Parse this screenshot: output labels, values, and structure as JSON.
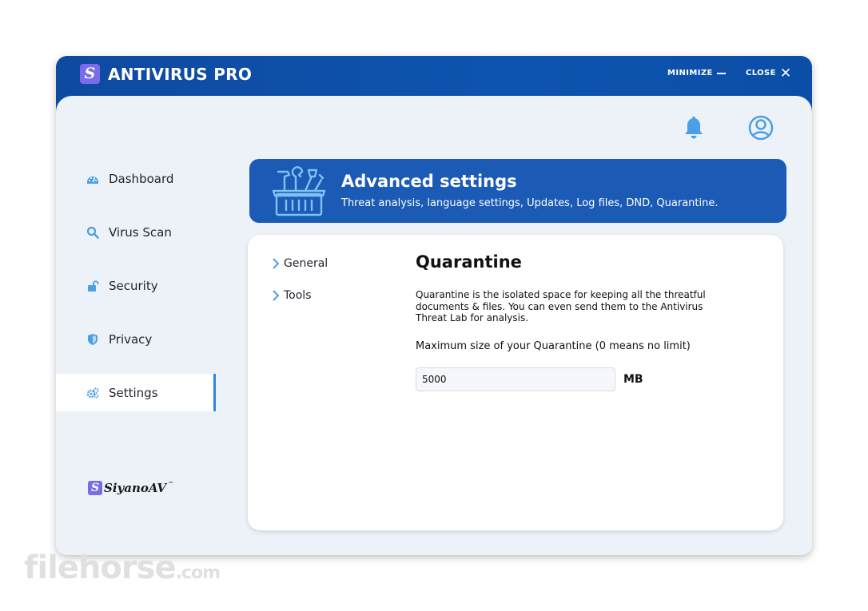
{
  "app": {
    "logo_letter": "S",
    "title": "ANTIVIRUS PRO"
  },
  "window_controls": {
    "minimize": "MINIMIZE",
    "close": "CLOSE"
  },
  "header_icons": [
    "bell-icon",
    "user-icon"
  ],
  "sidebar": {
    "items": [
      {
        "label": "Dashboard",
        "icon": "dashboard-icon",
        "active": false
      },
      {
        "label": "Virus Scan",
        "icon": "search-icon",
        "active": false
      },
      {
        "label": "Security",
        "icon": "lock-icon",
        "active": false
      },
      {
        "label": "Privacy",
        "icon": "shield-icon",
        "active": false
      },
      {
        "label": "Settings",
        "icon": "gears-icon",
        "active": true
      }
    ],
    "brand": {
      "letter": "S",
      "name": "SiyanoAV",
      "mark": "™"
    }
  },
  "banner": {
    "icon": "toolbox-icon",
    "title": "Advanced settings",
    "subtitle": "Threat analysis, language settings, Updates, Log files, DND, Quarantine."
  },
  "settings_nav": [
    {
      "label": "General"
    },
    {
      "label": "Tools"
    }
  ],
  "quarantine": {
    "title": "Quarantine",
    "description": "Quarantine is the isolated space for keeping all the threatful documents & files. You can even send them to the Antivirus Threat Lab for analysis.",
    "limit_label": "Maximum size of your Quarantine (0 means no limit)",
    "size_value": "5000",
    "unit": "MB"
  },
  "colors": {
    "titlebar": "#0d4fa8",
    "banner": "#1b5bb5",
    "accent": "#2e86de",
    "icon_blue": "#4a9fe6",
    "logo_purple": "#7a6ce8",
    "background": "#edf1f8"
  },
  "watermark": {
    "main": "filehorse",
    "suffix": ".com"
  }
}
